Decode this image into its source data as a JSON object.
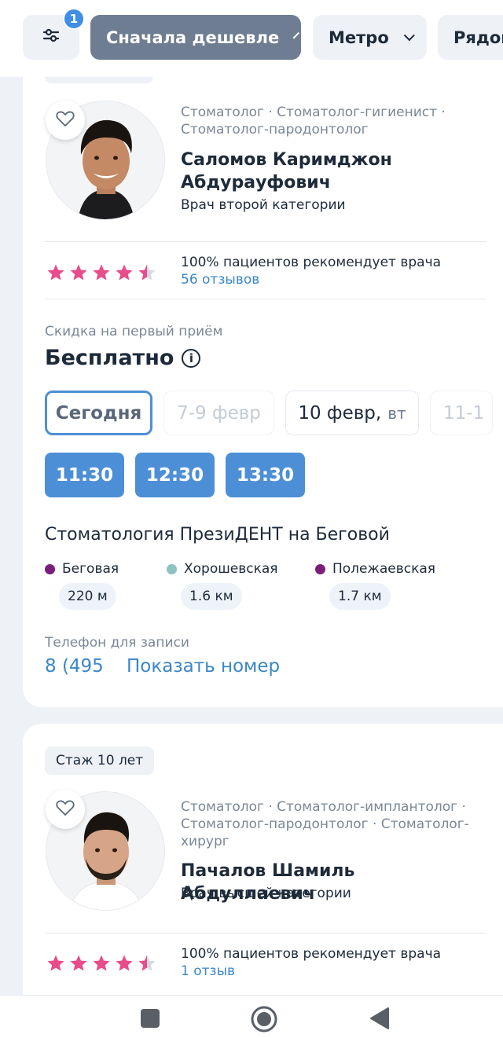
{
  "topbar": {
    "filter_badge": "1",
    "sort_label": "Сначала дешевле",
    "metro_label": "Метро",
    "near_label": "Рядом"
  },
  "card1": {
    "specialties": "Стоматолог · Стоматолог-гигиенист · Стоматолог-пародонтолог",
    "name": "Саломов Каримджон Абдурауфович",
    "category": "Врач второй категории",
    "rating": 4.5,
    "recommend": "100% пациентов рекомендует врача",
    "reviews": "56 отзывов",
    "discount_label": "Скидка на первый приём",
    "discount_value": "Бесплатно",
    "dates": {
      "today": "Сегодня",
      "range": "7-9 февр",
      "feb10": "10 февр,",
      "feb10_weekday": "вт",
      "next": "11-1"
    },
    "slots": [
      "11:30",
      "12:30",
      "13:30"
    ],
    "clinic": "Стоматология ПрезиДЕНТ на Беговой",
    "metro": [
      {
        "name": "Беговая",
        "distance": "220 м",
        "color": "#7b1e7a"
      },
      {
        "name": "Хорошевская",
        "distance": "1.6 км",
        "color": "#8ec3c2"
      },
      {
        "name": "Полежаевская",
        "distance": "1.7 км",
        "color": "#7b1e7a"
      }
    ],
    "phone_label": "Телефон для записи",
    "phone_prefix": "8 (495",
    "show_number": "Показать номер"
  },
  "card2": {
    "experience": "Стаж 10 лет",
    "specialties": "Стоматолог · Стоматолог-имплантолог · Стоматолог-пародонтолог · Стоматолог-хирург",
    "name": "Пачалов Шамиль Абдуллаевич",
    "category": "Врач высшей категории",
    "rating": 4.5,
    "recommend": "100% пациентов рекомендует врача",
    "reviews": "1 отзыв"
  },
  "colors": {
    "accent": "#4d8fd6",
    "link": "#3a86c9",
    "star": "#e84c8a",
    "sort_chip": "#6e7d91"
  },
  "icons": {
    "filter": "sliders-icon",
    "favorite": "heart-icon",
    "info": "info-icon",
    "nav_back": "triangle-back-icon",
    "nav_home": "circle-home-icon",
    "nav_recents": "square-recents-icon"
  }
}
